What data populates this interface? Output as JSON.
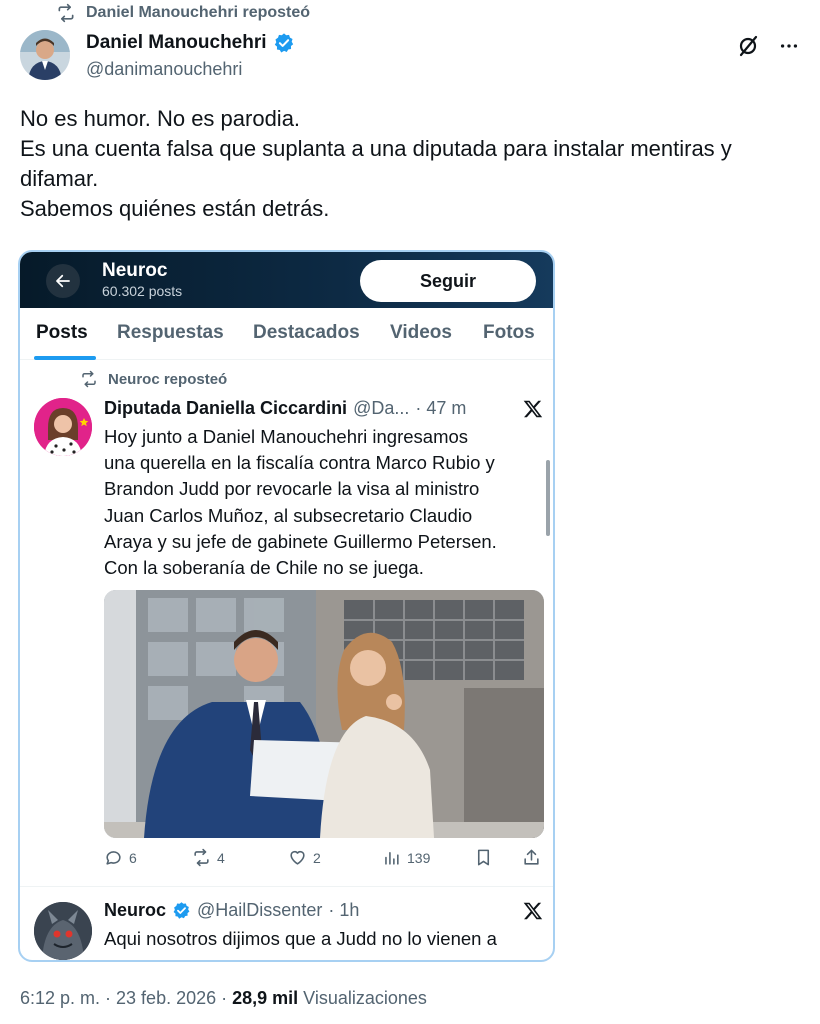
{
  "repost_header": {
    "text": "Daniel Manouchehri reposteó",
    "icon": "retweet-icon"
  },
  "author": {
    "name": "Daniel Manouchehri",
    "handle": "@danimanouchehri",
    "verified": true,
    "verified_color": "#1d9bf0"
  },
  "post": {
    "lines": [
      "No es humor. No es parodia.",
      "Es una cuenta falsa que suplanta a una diputada para instalar mentiras y difamar.",
      "Sabemos quiénes están detrás."
    ]
  },
  "screenshot": {
    "profile_name": "Neuroc",
    "profile_posts": "60.302 posts",
    "follow_label": "Seguir",
    "tabs": [
      "Posts",
      "Respuestas",
      "Destacados",
      "Videos",
      "Fotos"
    ],
    "active_tab": "Posts",
    "repost_label": "Neuroc reposteó",
    "tweet1": {
      "name": "Diputada Daniella Ciccardini",
      "handle": "@Da...",
      "time": "· 47 m",
      "text": "Hoy junto a Daniel Manouchehri ingresamos\nuna querella en la fiscalía contra Marco Rubio y\nBrandon Judd por revocarle la visa al ministro\nJuan Carlos Muñoz, al subsecretario Claudio\nAraya y su jefe de gabinete Guillermo Petersen.\nCon la soberanía de Chile no se juega.",
      "replies": "6",
      "reposts": "4",
      "likes": "2",
      "views": "139"
    },
    "tweet2": {
      "name": "Neuroc",
      "handle": "@HailDissenter",
      "time": "· 1h",
      "text": "Aqui nosotros dijimos que a Judd no lo vienen a"
    }
  },
  "footer": {
    "time_date": "6:12 p. m. · 23 feb. 2026 · ",
    "views_count": "28,9 mil",
    "views_label": " Visualizaciones"
  }
}
